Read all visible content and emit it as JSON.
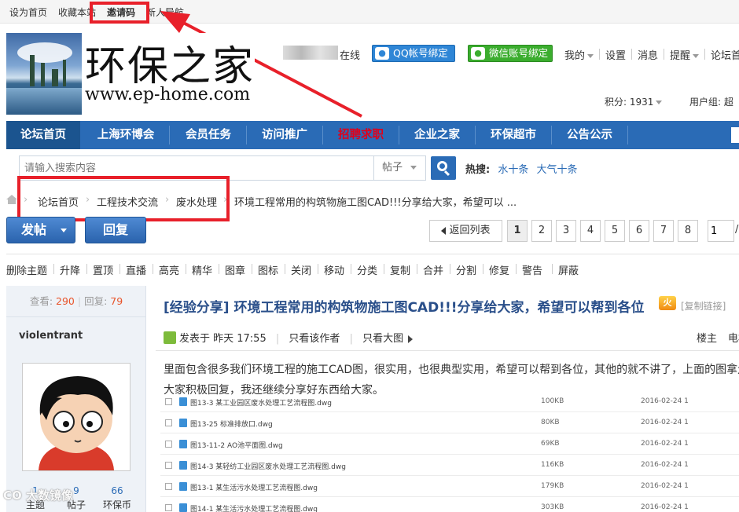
{
  "topbar": {
    "set_home": "设为首页",
    "bookmark": "收藏本站",
    "invite_code": "邀请码",
    "newbie_guide": "新人导航"
  },
  "logo": {
    "title": "环保之家",
    "url": "www.ep-home.com"
  },
  "userbar": {
    "online": "在线",
    "qq_bind": "QQ帐号绑定",
    "wechat_bind": "微信账号绑定",
    "mine": "我的",
    "settings": "设置",
    "messages": "消息",
    "reminders": "提醒",
    "forum_home_short": "论坛首",
    "points": "积分: 1931",
    "usergroup": "用户组: 超"
  },
  "nav": {
    "items": [
      {
        "label": "论坛首页"
      },
      {
        "label": "上海环博会"
      },
      {
        "label": "会员任务"
      },
      {
        "label": "访问推广"
      },
      {
        "label": "招聘求职"
      },
      {
        "label": "企业之家"
      },
      {
        "label": "环保超市"
      },
      {
        "label": "公告公示"
      }
    ]
  },
  "search": {
    "placeholder": "请输入搜索内容",
    "scope": "帖子",
    "hot_label": "热搜:",
    "hot_terms": [
      "水十条",
      "大气十条"
    ]
  },
  "breadcrumb": {
    "items": [
      "论坛首页",
      "工程技术交流",
      "废水处理"
    ],
    "current": "环境工程常用的构筑物施工图CAD!!!分享给大家，希望可以 ..."
  },
  "actions": {
    "post": "发帖",
    "reply": "回复"
  },
  "pager": {
    "back": "返回列表",
    "pages": [
      "1",
      "2",
      "3",
      "4",
      "5",
      "6",
      "7",
      "8"
    ],
    "current": "1",
    "input_value": "1",
    "slash": "/"
  },
  "moderation": [
    "删除主题",
    "升降",
    "置顶",
    "直播",
    "高亮",
    "精华",
    "图章",
    "图标",
    "关闭",
    "移动",
    "分类",
    "复制",
    "合并",
    "分割",
    "修复",
    "警告",
    "屏蔽"
  ],
  "user": {
    "views_label": "查看:",
    "views": "290",
    "replies_label": "回复:",
    "replies": "79",
    "name": "violentrant",
    "threads_count": "1",
    "posts_count": "9",
    "coins_count": "66",
    "threads_label": "主题",
    "posts_label": "帖子",
    "coins_label": "环保币"
  },
  "thread": {
    "title": "[经验分享] 环境工程常用的构筑物施工图CAD!!!分享给大家，希望可以帮到各位",
    "copy_link": "[复制链接]",
    "posted": "发表于 昨天 17:55",
    "only_author": "只看该作者",
    "only_big_img": "只看大图",
    "floor": "楼主",
    "floor_extra": "电梯",
    "body": "里面包含很多我们环境工程的施工CAD图，很实用，也很典型实用，希望可以帮到各位，其他的就不讲了，上面的图拿走，大家积极回复，我还继续分享好东西给大家。",
    "files": [
      {
        "name": "图13-3 某工业园区废水处理工艺流程图.dwg",
        "size": "100KB",
        "date": "2016-02-24 1"
      },
      {
        "name": "图13-25 标准排放口.dwg",
        "size": "80KB",
        "date": "2016-02-24 1"
      },
      {
        "name": "图13-11-2 AO池平面图.dwg",
        "size": "69KB",
        "date": "2016-02-24 1"
      },
      {
        "name": "图14-3 某轻纺工业园区废水处理工艺流程图.dwg",
        "size": "116KB",
        "date": "2016-02-24 1"
      },
      {
        "name": "图13-1 某生活污水处理工艺流程图.dwg",
        "size": "179KB",
        "date": "2016-02-24 1"
      },
      {
        "name": "图14-1 某生活污水处理工艺流程图.dwg",
        "size": "303KB",
        "date": "2016-02-24 1"
      }
    ]
  },
  "watermark": "CO 大数镜像",
  "colors": {
    "nav_bg": "#2a6bb6",
    "highlight_red": "#e8202a",
    "qq_blue": "#2f86d6",
    "wechat_green": "#3bad2e"
  }
}
